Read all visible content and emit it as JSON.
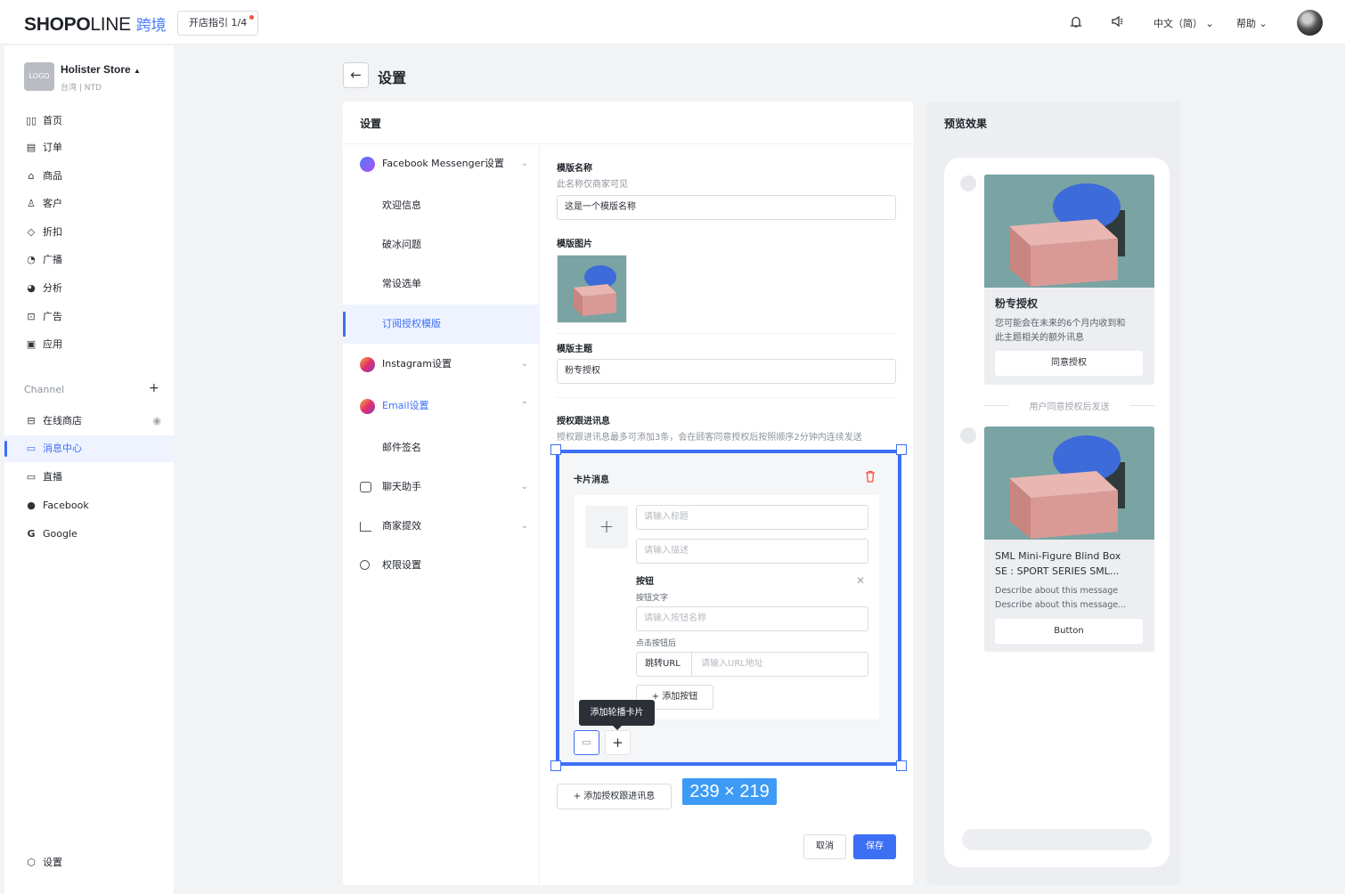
{
  "topbar": {
    "logo_main": "SHOP",
    "logo_o": "O",
    "logo_rest": "LINE",
    "logo_cn": "跨境",
    "guide": "开店指引 1/4",
    "language": "中文（简）",
    "help": "帮助"
  },
  "sidebar": {
    "store_logo": "LOGO",
    "store_name": "Holister Store",
    "store_sub": "台湾 | NTD",
    "items": [
      {
        "label": "首页",
        "icon": "home-icon"
      },
      {
        "label": "订单",
        "icon": "order-icon"
      },
      {
        "label": "商品",
        "icon": "bag-icon"
      },
      {
        "label": "客户",
        "icon": "user-icon"
      },
      {
        "label": "折扣",
        "icon": "tag-icon"
      },
      {
        "label": "广播",
        "icon": "broadcast-icon"
      },
      {
        "label": "分析",
        "icon": "chart-icon"
      },
      {
        "label": "广告",
        "icon": "ad-icon"
      },
      {
        "label": "应用",
        "icon": "app-icon"
      }
    ],
    "channel_label": "Channel",
    "channels": [
      {
        "label": "在线商店",
        "icon": "store-icon"
      },
      {
        "label": "消息中心",
        "icon": "message-icon",
        "active": true
      },
      {
        "label": "直播",
        "icon": "live-icon"
      },
      {
        "label": "Facebook",
        "icon": "facebook-icon"
      },
      {
        "label": "Google",
        "icon": "google-icon"
      }
    ],
    "settings": "设置"
  },
  "page": {
    "title": "设置"
  },
  "main": {
    "header": "设置",
    "menu": [
      {
        "label": "Facebook Messenger设置"
      },
      {
        "label": "欢迎信息"
      },
      {
        "label": "破冰问题"
      },
      {
        "label": "常设选单"
      },
      {
        "label": "订阅授权模版"
      },
      {
        "label": "Instagram设置"
      },
      {
        "label": "Email设置"
      },
      {
        "label": "邮件签名"
      },
      {
        "label": "聊天助手"
      },
      {
        "label": "商家提效"
      },
      {
        "label": "权限设置"
      }
    ],
    "form": {
      "name_label": "模版名称",
      "name_hint": "此名称仅商家可见",
      "name_value": "这是一个模版名称",
      "image_label": "模版图片",
      "topic_label": "模版主题",
      "topic_value": "粉专授权",
      "follow_label": "授权跟进讯息",
      "follow_hint": "授权跟进讯息最多可添加3条，会在顾客同意授权后按照顺序2分钟内连续发送"
    },
    "card": {
      "title": "卡片消息",
      "title_placeholder": "请输入标题",
      "desc_placeholder": "请输入描述",
      "button_label": "按钮",
      "button_text_label": "按钮文字",
      "button_name_placeholder": "请输入按钮名称",
      "after_click_label": "点击按钮后",
      "url_prefix": "跳转URL",
      "url_placeholder": "请输入URL地址",
      "add_button": "添加按钮",
      "tooltip": "添加轮播卡片"
    },
    "selection_size": "239 × 219",
    "add_follow": "添加授权跟进讯息",
    "cancel": "取消",
    "save": "保存"
  },
  "preview": {
    "header": "预览效果",
    "card1": {
      "title": "粉专授权",
      "desc_line1": "您可能会在未来的6个月内收到和",
      "desc_line2": "此主题相关的额外讯息",
      "button": "同意授权"
    },
    "divider": "用户同意授权后发送",
    "card2": {
      "title_line1": "SML Mini-Figure Blind Box",
      "title_line2": "SE : SPORT SERIES SML...",
      "desc_line1": "Describe about this message",
      "desc_line2": "Describe about this message...",
      "button": "Button"
    }
  },
  "colors": {
    "accent": "#3d6ff5",
    "danger": "#f5533d",
    "badge": "#3d9bf5"
  }
}
